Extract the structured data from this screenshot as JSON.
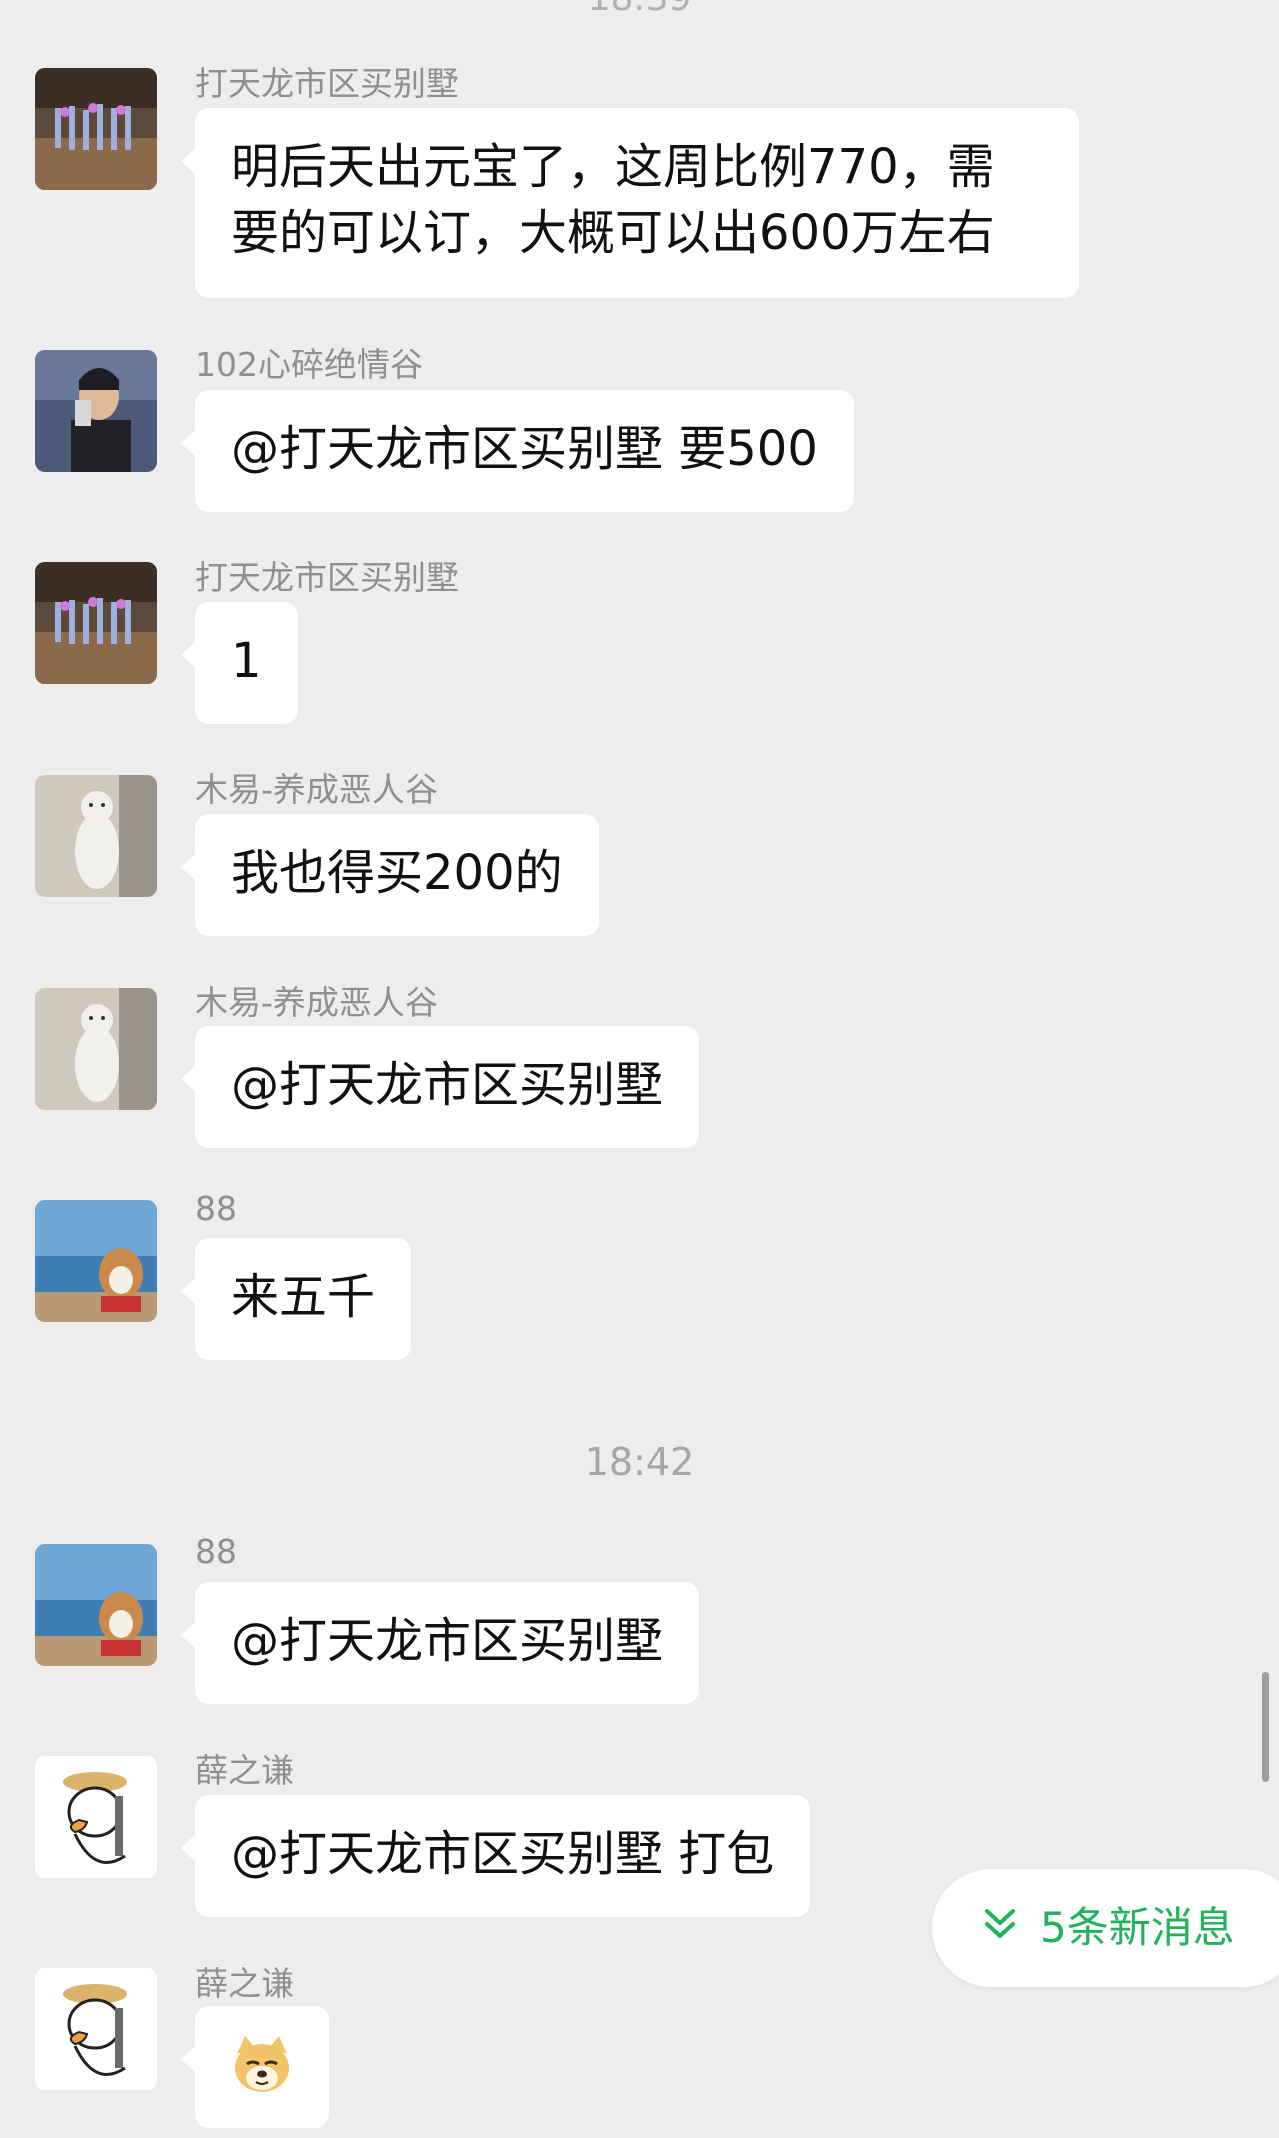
{
  "top_time_partial": "18:39",
  "messages": [
    {
      "sender": "打天龙市区买别墅",
      "text_lines": [
        "明后天出元宝了，这周比例770，需",
        "要的可以订，大概可以出600万左右"
      ],
      "avatar": "game-scene-avatar"
    },
    {
      "sender": "102心碎绝情谷",
      "text": "@打天龙市区买别墅 要500",
      "avatar": "man-drinking-avatar"
    },
    {
      "sender": "打天龙市区买别墅",
      "text": "1",
      "avatar": "game-scene-avatar"
    },
    {
      "sender": "木易-养成恶人谷",
      "text": "我也得买200的",
      "avatar": "cat-avatar"
    },
    {
      "sender": "木易-养成恶人谷",
      "text": "@打天龙市区买别墅",
      "avatar": "cat-avatar"
    },
    {
      "sender": "88",
      "text": "来五千",
      "avatar": "dog-sea-avatar"
    },
    {
      "sender": "88",
      "text": "@打天龙市区买别墅",
      "avatar": "dog-sea-avatar"
    },
    {
      "sender": "薛之谦",
      "text": "@打天龙市区买别墅 打包",
      "avatar": "cartoon-goose-avatar"
    },
    {
      "sender": "薛之谦",
      "emoji": "doge-emoji",
      "avatar": "cartoon-goose-avatar"
    }
  ],
  "time_separator": "18:42",
  "new_messages_button": {
    "label": "5条新消息",
    "icon": "double-chevron-down-icon",
    "color": "#21b25a"
  },
  "colors": {
    "background": "#ededed",
    "bubble": "#ffffff",
    "sender_name": "#8f8f8f",
    "accent_green": "#21b25a"
  }
}
